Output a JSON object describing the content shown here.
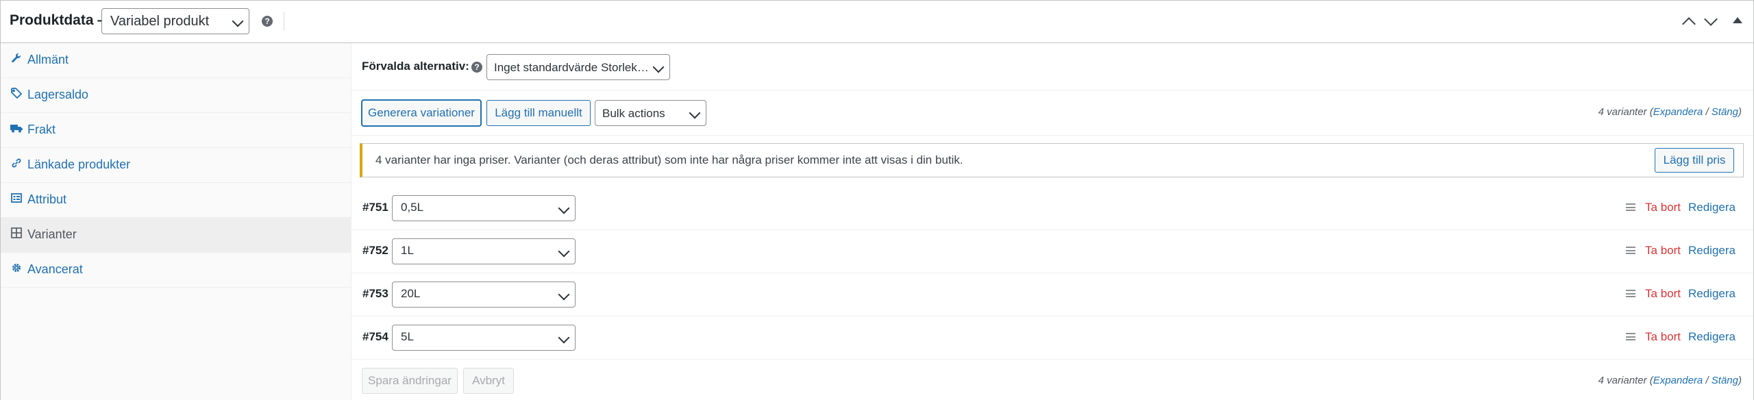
{
  "header": {
    "title": "Produktdata —",
    "product_type": "Variabel produkt"
  },
  "sidebar": {
    "items": [
      {
        "label": "Allmänt",
        "icon": "wrench-icon"
      },
      {
        "label": "Lagersaldo",
        "icon": "tag-icon"
      },
      {
        "label": "Frakt",
        "icon": "truck-icon"
      },
      {
        "label": "Länkade produkter",
        "icon": "link-icon"
      },
      {
        "label": "Attribut",
        "icon": "list-card-icon"
      },
      {
        "label": "Varianter",
        "icon": "grid-icon",
        "active": true
      },
      {
        "label": "Avancerat",
        "icon": "gear-icon"
      }
    ]
  },
  "defaults": {
    "label": "Förvalda alternativ:",
    "value": "Inget standardvärde Storlek…"
  },
  "toolbar": {
    "generate": "Generera variationer",
    "add_manual": "Lägg till manuellt",
    "bulk": "Bulk actions"
  },
  "count_top": {
    "text": "4 varianter (",
    "expand": "Expandera",
    "sep": " / ",
    "close": "Stäng",
    "end": ")"
  },
  "notice": {
    "text": "4 varianter har inga priser. Varianter (och deras attribut) som inte har några priser kommer inte att visas i din butik.",
    "button": "Lägg till pris"
  },
  "variations": [
    {
      "id": "#751",
      "value": "0,5L"
    },
    {
      "id": "#752",
      "value": "1L"
    },
    {
      "id": "#753",
      "value": "20L"
    },
    {
      "id": "#754",
      "value": "5L"
    }
  ],
  "row_actions": {
    "remove": "Ta bort",
    "edit": "Redigera"
  },
  "footer": {
    "save": "Spara ändringar",
    "cancel": "Avbryt"
  },
  "colors": {
    "accent": "#2271b1",
    "danger": "#d63638",
    "warning": "#dba617"
  }
}
